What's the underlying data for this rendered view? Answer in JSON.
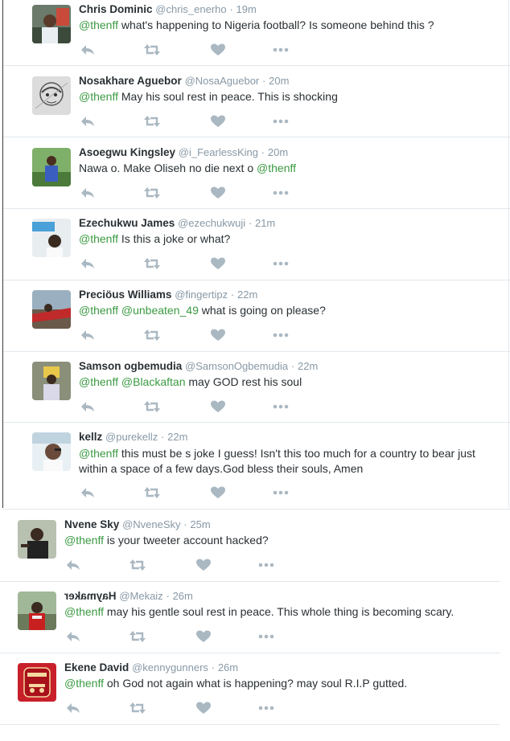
{
  "tweets": [
    {
      "name": "Chris Dominic",
      "handle": "@chris_enerho",
      "separator": "·",
      "time": "19m",
      "segments": [
        {
          "type": "mention",
          "text": "@thenff"
        },
        {
          "type": "text",
          "text": " what's happening to Nigeria football?  Is someone behind this ?"
        }
      ]
    },
    {
      "name": "Nosakhare Aguebor",
      "handle": "@NosaAguebor",
      "separator": "·",
      "time": "20m",
      "segments": [
        {
          "type": "mention",
          "text": "@thenff"
        },
        {
          "type": "text",
          "text": " May his soul rest in peace. This is shocking"
        }
      ]
    },
    {
      "name": "Asoegwu Kingsley",
      "handle": "@i_FearlessKing",
      "separator": "·",
      "time": "20m",
      "segments": [
        {
          "type": "text",
          "text": "Nawa o. Make Oliseh no die next o "
        },
        {
          "type": "mention",
          "text": "@thenff"
        }
      ]
    },
    {
      "name": "Ezechukwu James",
      "handle": "@ezechukwuji",
      "separator": "·",
      "time": "21m",
      "segments": [
        {
          "type": "mention",
          "text": "@thenff"
        },
        {
          "type": "text",
          "text": " Is this a joke or what?"
        }
      ]
    },
    {
      "name": "Preciöus Williams",
      "handle": "@fingertipz",
      "separator": "·",
      "time": "22m",
      "segments": [
        {
          "type": "mention",
          "text": "@thenff"
        },
        {
          "type": "text",
          "text": " "
        },
        {
          "type": "mention",
          "text": "@unbeaten_49"
        },
        {
          "type": "text",
          "text": " what is going on please?"
        }
      ]
    },
    {
      "name": "Samson ogbemudia",
      "handle": "@SamsonOgbemudia",
      "separator": "·",
      "time": "22m",
      "segments": [
        {
          "type": "mention",
          "text": "@thenff"
        },
        {
          "type": "text",
          "text": " "
        },
        {
          "type": "mention",
          "text": "@Blackaftan"
        },
        {
          "type": "text",
          "text": "  may GOD rest his soul"
        }
      ]
    },
    {
      "name": "kellz",
      "handle": "@purekellz",
      "separator": "·",
      "time": "22m",
      "segments": [
        {
          "type": "mention",
          "text": "@thenff"
        },
        {
          "type": "text",
          "text": " this must be s joke I guess! Isn't this too much for a country to bear just within a space of a few days.God bless their souls, Amen"
        }
      ]
    },
    {
      "name": "Nvene Sky",
      "handle": "@NveneSky",
      "separator": "·",
      "time": "25m",
      "segments": [
        {
          "type": "mention",
          "text": "@thenff"
        },
        {
          "type": "text",
          "text": " is your tweeter account hacked?"
        }
      ]
    },
    {
      "name": "Haymaker",
      "handle": "@Mekaiz",
      "separator": "·",
      "time": "26m",
      "segments": [
        {
          "type": "mention",
          "text": "@thenff"
        },
        {
          "type": "text",
          "text": " may his gentle soul rest in peace. This whole thing is becoming scary."
        }
      ]
    },
    {
      "name": "Ekene David",
      "handle": "@kennygunners",
      "separator": "·",
      "time": "26m",
      "segments": [
        {
          "type": "mention",
          "text": "@thenff"
        },
        {
          "type": "text",
          "text": " oh God not again what is happening? may soul R.I.P gutted."
        }
      ]
    }
  ],
  "icons": {
    "reply": "reply-icon",
    "retweet": "retweet-icon",
    "like": "heart-icon",
    "more": "more-icon"
  },
  "colors": {
    "mention": "#3b9a42",
    "meta": "#8899a6",
    "icon": "#aab8c2",
    "text": "#292f33",
    "divider": "#e1e8ed"
  }
}
